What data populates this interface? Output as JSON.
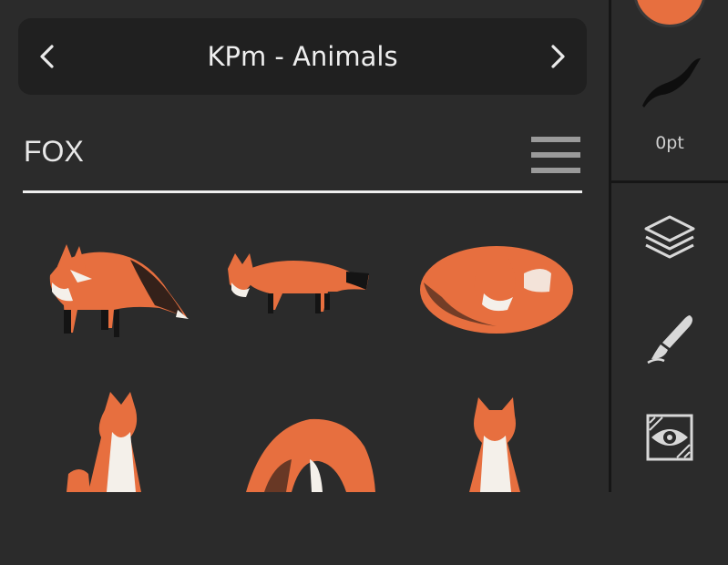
{
  "library": {
    "title": "KPm - Animals",
    "prev_icon": "chevron-left-icon",
    "next_icon": "chevron-right-icon"
  },
  "category": {
    "title": "FOX",
    "menu_icon": "hamburger-menu-icon"
  },
  "stamps": [
    {
      "name": "fox-looking-back"
    },
    {
      "name": "fox-walking"
    },
    {
      "name": "fox-curled-sleeping"
    },
    {
      "name": "fox-sitting-with-kit"
    },
    {
      "name": "fox-pouncing"
    },
    {
      "name": "fox-sitting-front"
    }
  ],
  "sidebar": {
    "brush_size": "0pt",
    "tools": [
      "layers-icon",
      "brush-icon",
      "visibility-icon"
    ]
  },
  "colors": {
    "accent": "#e76f3f",
    "background": "#2b2b2b",
    "nav_background": "#202020"
  }
}
